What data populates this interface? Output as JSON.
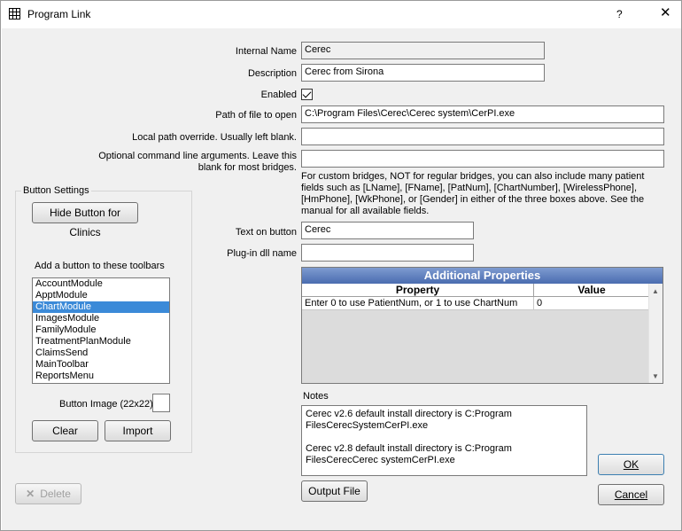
{
  "window": {
    "title": "Program Link",
    "help_label": "?",
    "close_label": "✕"
  },
  "form": {
    "internal_name_label": "Internal Name",
    "internal_name_value": "Cerec",
    "description_label": "Description",
    "description_value": "Cerec from Sirona",
    "enabled_label": "Enabled",
    "enabled_checked": true,
    "path_label": "Path of file to open",
    "path_value": "C:\\Program Files\\Cerec\\Cerec system\\CerPI.exe",
    "override_label": "Local path override.  Usually left blank.",
    "override_value": "",
    "args_label_line1": "Optional command line arguments.  Leave this",
    "args_label_line2": "blank for most bridges.",
    "args_value": "",
    "custom_info": "For custom bridges, NOT for regular bridges, you can also include many patient fields such as [LName], [FName], [PatNum], [ChartNumber], [WirelessPhone], [HmPhone], [WkPhone], or [Gender] in either of the three boxes above. See the manual for all available fields.",
    "text_on_button_label": "Text on button",
    "text_on_button_value": "Cerec",
    "plugin_label": "Plug-in dll name",
    "plugin_value": ""
  },
  "button_settings": {
    "group_title": "Button Settings",
    "hide_button_label": "Hide Button for Clinics",
    "toolbars_label": "Add a button to these toolbars",
    "toolbars": [
      "AccountModule",
      "ApptModule",
      "ChartModule",
      "ImagesModule",
      "FamilyModule",
      "TreatmentPlanModule",
      "ClaimsSend",
      "MainToolbar",
      "ReportsMenu"
    ],
    "selected_toolbar": "ChartModule",
    "button_image_label": "Button Image (22x22)",
    "clear_label": "Clear",
    "import_label": "Import"
  },
  "properties": {
    "title": "Additional Properties",
    "col_property": "Property",
    "col_value": "Value",
    "rows": [
      {
        "property": "Enter 0 to use PatientNum, or 1 to use ChartNum",
        "value": "0"
      }
    ]
  },
  "notes": {
    "label": "Notes",
    "line1": "Cerec v2.6 default install directory is C:Program FilesCerecSystemCerPI.exe",
    "line2": "Cerec v2.8 default install directory is C:Program FilesCerecCerec systemCerPI.exe"
  },
  "footer": {
    "delete_label": "Delete",
    "output_file_label": "Output File",
    "ok_label": "OK",
    "cancel_label": "Cancel"
  },
  "colors": {
    "selection": "#3b8ad8",
    "grid_title_bg": "#4a6cb0",
    "dialog_bg": "#f0f0f0"
  }
}
